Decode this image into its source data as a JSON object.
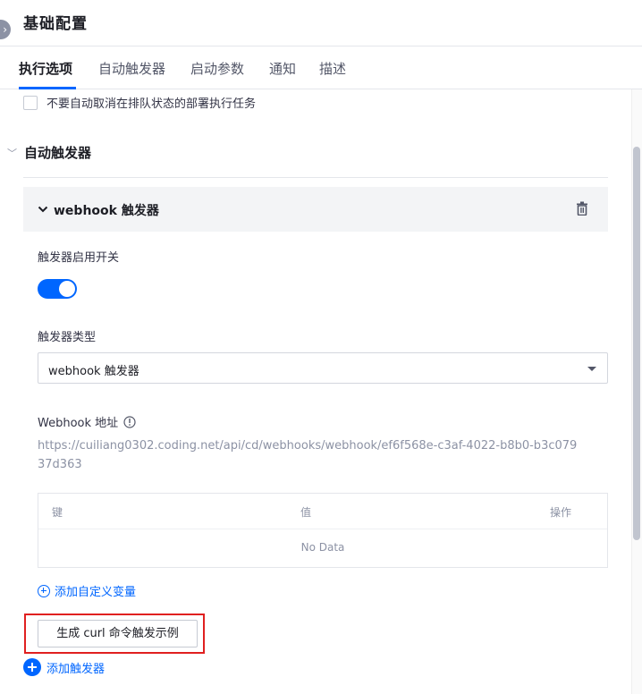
{
  "header": {
    "title": "基础配置",
    "collapse_icon": "chevron-right-icon"
  },
  "tabs": [
    {
      "label": "执行选项",
      "active": true
    },
    {
      "label": "自动触发器",
      "active": false
    },
    {
      "label": "启动参数",
      "active": false
    },
    {
      "label": "通知",
      "active": false
    },
    {
      "label": "描述",
      "active": false
    }
  ],
  "options": {
    "no_auto_cancel_label": "不要自动取消在排队状态的部署执行任务",
    "no_auto_cancel_checked": false
  },
  "section": {
    "title": "自动触发器",
    "expanded": true
  },
  "trigger_card": {
    "title": "webhook 触发器",
    "expanded": true,
    "enable_label": "触发器启用开关",
    "enabled": true,
    "type_label": "触发器类型",
    "type_value": "webhook 触发器",
    "webhook_label": "Webhook 地址",
    "webhook_url": "https://cuiliang0302.coding.net/api/cd/webhooks/webhook/ef6f568e-c3af-4022-b8b0-b3c07937d363",
    "table": {
      "columns": [
        "键",
        "值",
        "操作"
      ],
      "empty_text": "No Data"
    },
    "add_variable_label": "添加自定义变量",
    "curl_button_label": "生成 curl 命令触发示例"
  },
  "add_trigger_label": "添加触发器",
  "colors": {
    "accent": "#0066ff",
    "highlight": "#e02020"
  }
}
